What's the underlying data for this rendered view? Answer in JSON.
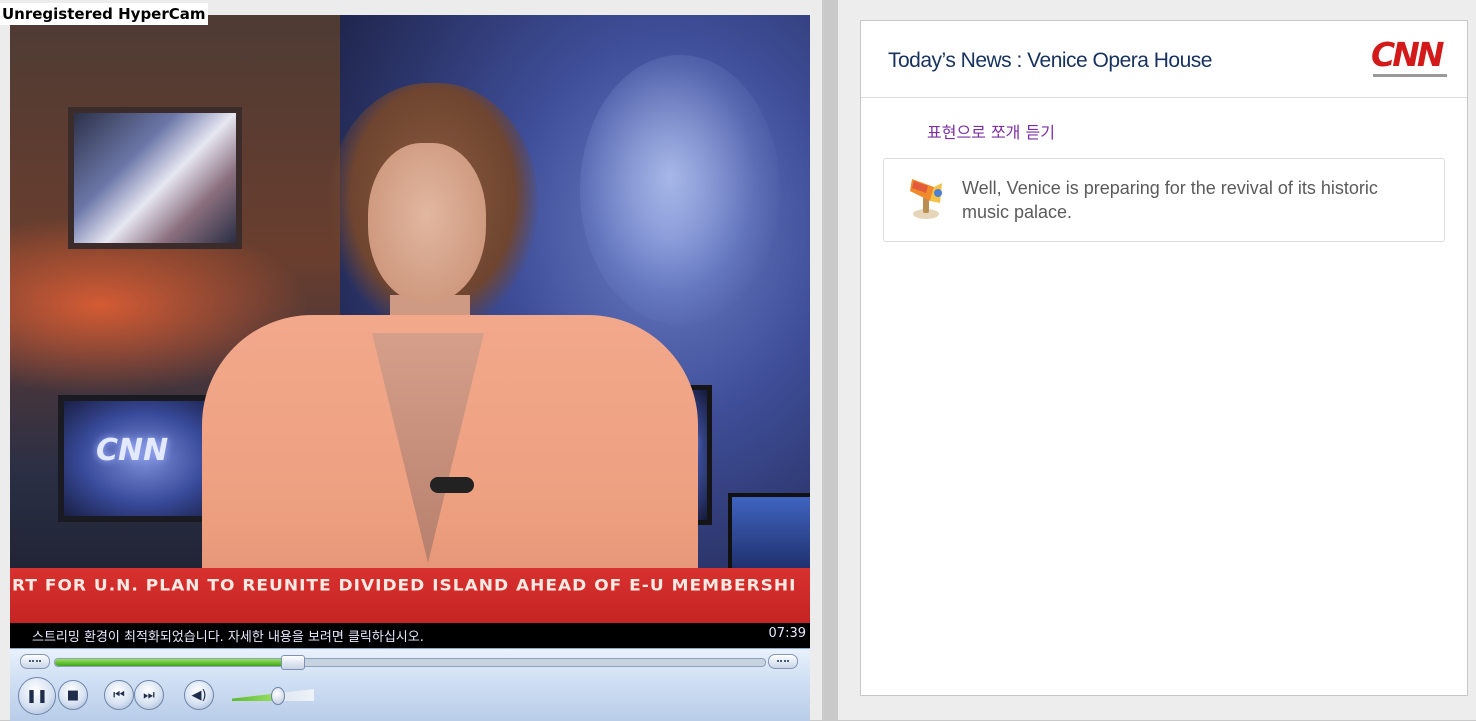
{
  "watermark": "Unregistered HyperCam",
  "player": {
    "video": {
      "ticker": "RT FOR U.N. PLAN TO REUNITE DIVIDED ISLAND AHEAD OF E-U MEMBERSHI",
      "channel_logo": "CNN"
    },
    "status": {
      "message": "스트리밍 환경이 최적화되었습니다. 자세한 내용을 보려면 클릭하십시오.",
      "time": "07:39"
    },
    "controls": {
      "seek_progress_percent": 33,
      "volume_percent": 55,
      "icons": {
        "play_pause": "pause-icon",
        "stop": "stop-icon",
        "previous": "previous-icon",
        "next": "next-icon",
        "mute": "speaker-icon"
      },
      "glyphs": {
        "play_pause": "❚❚",
        "stop": "■",
        "previous": "⏮",
        "next": "⏭",
        "mute": "◀)"
      }
    }
  },
  "news": {
    "title": "Today’s News : Venice Opera House",
    "logo": "CNN",
    "section_label": "표현으로 쪼개 듣기",
    "transcript": "Well, Venice is preparing for the revival of its historic music palace.",
    "colors": {
      "title": "#17325f",
      "section_label": "#7b2fa0",
      "logo": "#d21a1a"
    }
  }
}
